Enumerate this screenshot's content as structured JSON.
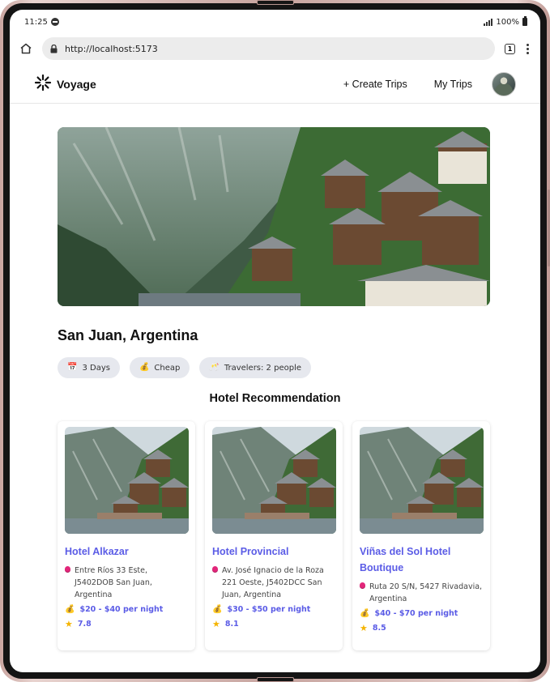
{
  "status_bar": {
    "time": "11:25",
    "battery": "100%"
  },
  "browser": {
    "url": "http://localhost:5173",
    "tab_count": "1"
  },
  "header": {
    "brand": "Voyage",
    "create_trips": "+ Create Trips",
    "my_trips": "My Trips"
  },
  "trip": {
    "location": "San Juan, Argentina",
    "chips": {
      "days": "3 Days",
      "budget": "Cheap",
      "travelers": "Travelers: 2 people"
    }
  },
  "hotels_section": {
    "title": "Hotel Recommendation",
    "items": [
      {
        "name": "Hotel Alkazar",
        "address": "Entre Ríos 33 Este, J5402DOB San Juan, Argentina",
        "price": "$20 - $40 per night",
        "rating": "7.8"
      },
      {
        "name": "Hotel Provincial",
        "address": "Av. José Ignacio de la Roza 221 Oeste, J5402DCC San Juan, Argentina",
        "price": "$30 - $50 per night",
        "rating": "8.1"
      },
      {
        "name": "Viñas del Sol Hotel Boutique",
        "address": "Ruta 20 S/N, 5427 Rivadavia, Argentina",
        "price": "$40 - $70 per night",
        "rating": "8.5"
      }
    ]
  },
  "colors": {
    "accent": "#5b5ce6",
    "chip_bg": "#e6e8ee",
    "pin": "#e2267a",
    "star": "#f5b400"
  },
  "icons": [
    "home-icon",
    "lock-icon",
    "tabs-icon",
    "more-icon",
    "logo-icon",
    "avatar",
    "calendar-icon",
    "money-bag-icon",
    "travelers-icon",
    "location-pin-icon",
    "star-icon"
  ]
}
